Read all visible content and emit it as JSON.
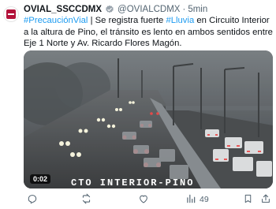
{
  "tweet": {
    "display_name": "OVIAL_SSCCDMX",
    "handle": "@OVIALCDMX",
    "separator": "·",
    "time": "5min",
    "text": {
      "hashtag_1": "#PrecauciónVial",
      "part_1": " | Se registra fuerte ",
      "hashtag_2": "#Lluvia",
      "part_2": " en Circuito Interior a la altura de Pino, el tránsito es lento en ambos sentidos entre Eje 1 Norte y Av. Ricardo Flores Magón."
    },
    "media": {
      "duration": "0:02",
      "overlay_caption": "CTO INTERIOR-PINO"
    },
    "actions": {
      "views_count": "49"
    },
    "colors": {
      "accent": "#1d9bf0",
      "brand": "#b3123a",
      "secondary_text": "#536471"
    }
  }
}
